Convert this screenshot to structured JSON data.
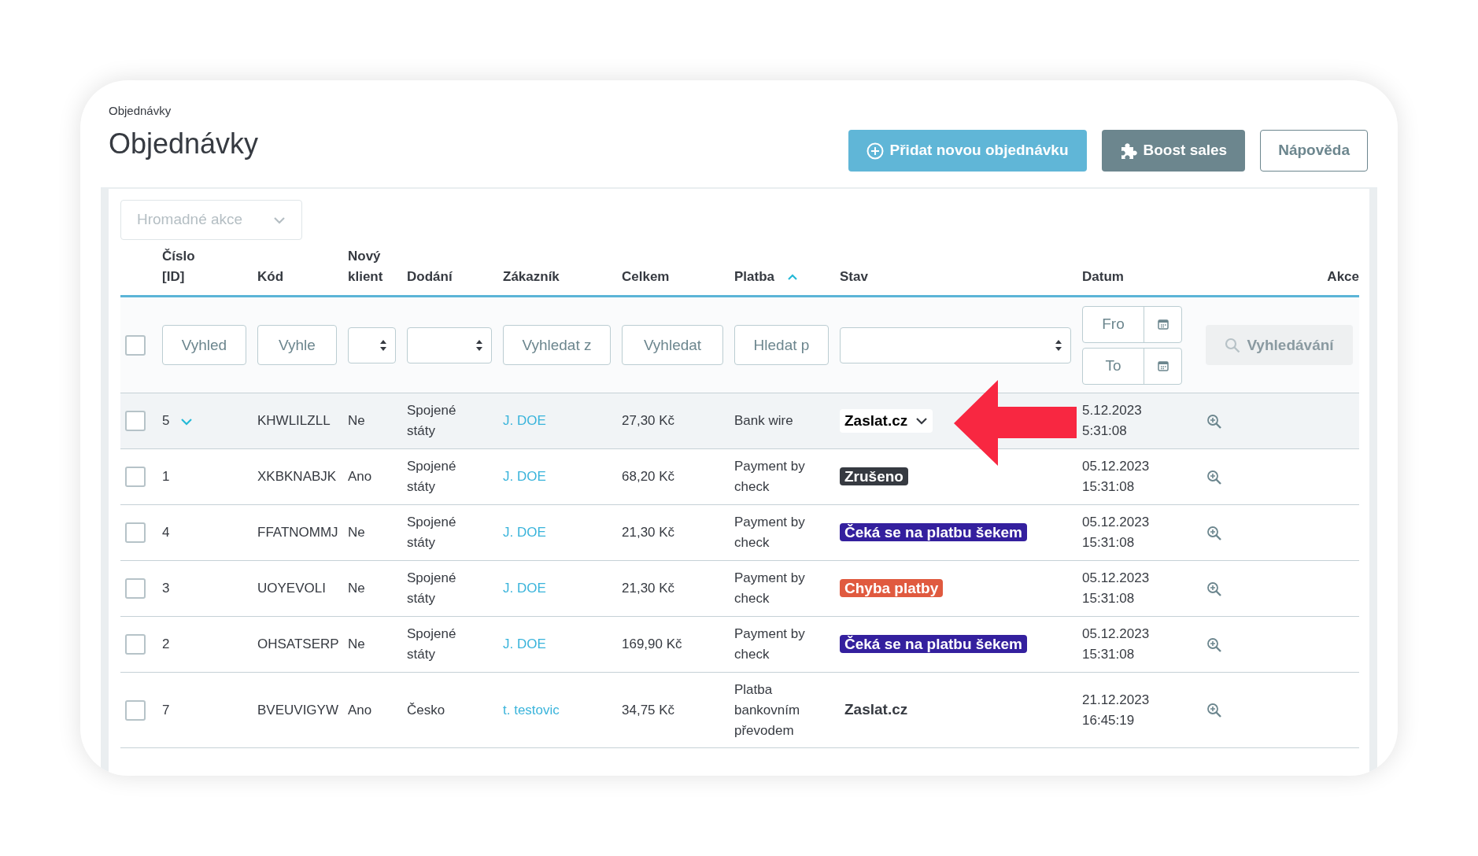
{
  "breadcrumb": "Objednávky",
  "title": "Objednávky",
  "header_buttons": [
    {
      "label": "Přidat novou objednávku",
      "kind": "primary"
    },
    {
      "label": "Boost sales",
      "kind": "secondary"
    },
    {
      "label": "Nápověda",
      "kind": "outline"
    }
  ],
  "bulk_actions": {
    "label": "Hromadné akce",
    "disabled": true
  },
  "table": {
    "columns": [
      {
        "sorted_ascending": false
      },
      {
        "label": "Číslo [ID]",
        "sorted_ascending": false
      },
      {
        "label": "Kód",
        "sorted_ascending": false
      },
      {
        "label": "Nový klient",
        "sorted_ascending": false
      },
      {
        "label": "Dodání",
        "sorted_ascending": false
      },
      {
        "label": "Zákazník",
        "sorted_ascending": false
      },
      {
        "label": "Celkem",
        "sorted_ascending": false
      },
      {
        "label": "Platba",
        "sorted_ascending": true
      },
      {
        "label": "Stav",
        "sorted_ascending": false
      },
      {
        "label": "Datum",
        "sorted_ascending": false
      },
      {
        "label": "Akce",
        "sorted_ascending": false
      }
    ],
    "filters": [
      {
        "kind": "checkbox",
        "checked": false
      },
      {
        "kind": "text",
        "placeholder": "Vyhled"
      },
      {
        "kind": "text",
        "placeholder": "Vyhle"
      },
      {
        "kind": "select"
      },
      {
        "kind": "select"
      },
      {
        "kind": "text",
        "placeholder": "Vyhledat z"
      },
      {
        "kind": "text",
        "placeholder": "Vyhledat"
      },
      {
        "kind": "text",
        "placeholder": "Hledat p"
      },
      {
        "kind": "select"
      },
      {
        "kind": "date_range",
        "from_placeholder": "Fro",
        "to_placeholder": "To"
      },
      {
        "kind": "button",
        "label": "Vyhledávání",
        "disabled": true
      }
    ],
    "rows": [
      {
        "checked": false,
        "highlighted": true,
        "expandable": true,
        "id": "5",
        "code": "KHWLILZLL",
        "new_client": "Ne",
        "delivery": "Spojené státy",
        "customer": "J. DOE",
        "total": "27,30 Kč",
        "payment": "Bank wire",
        "status": {
          "kind": "dropdown",
          "label": "Zaslat.cz"
        },
        "date": "5.12.2023",
        "time": "5:31:08"
      },
      {
        "checked": false,
        "highlighted": false,
        "expandable": false,
        "id": "1",
        "code": "XKBKNABJK",
        "new_client": "Ano",
        "delivery": "Spojené státy",
        "customer": "J. DOE",
        "total": "68,20 Kč",
        "payment": "Payment by check",
        "status": {
          "kind": "badge",
          "label": "Zrušeno",
          "color": "#363a41"
        },
        "date": "05.12.2023",
        "time": "15:31:08"
      },
      {
        "checked": false,
        "highlighted": false,
        "expandable": false,
        "id": "4",
        "code": "FFATNOMMJ",
        "new_client": "Ne",
        "delivery": "Spojené státy",
        "customer": "J. DOE",
        "total": "21,30 Kč",
        "payment": "Payment by check",
        "status": {
          "kind": "badge",
          "label": "Čeká se na platbu šekem",
          "color": "#34209e"
        },
        "date": "05.12.2023",
        "time": "15:31:08"
      },
      {
        "checked": false,
        "highlighted": false,
        "expandable": false,
        "id": "3",
        "code": "UOYEVOLI",
        "new_client": "Ne",
        "delivery": "Spojené státy",
        "customer": "J. DOE",
        "total": "21,30 Kč",
        "payment": "Payment by check",
        "status": {
          "kind": "badge",
          "label": "Chyba platby",
          "color": "#e05a3f"
        },
        "date": "05.12.2023",
        "time": "15:31:08"
      },
      {
        "checked": false,
        "highlighted": false,
        "expandable": false,
        "id": "2",
        "code": "OHSATSERP",
        "new_client": "Ne",
        "delivery": "Spojené státy",
        "customer": "J. DOE",
        "total": "169,90 Kč",
        "payment": "Payment by check",
        "status": {
          "kind": "badge",
          "label": "Čeká se na platbu šekem",
          "color": "#34209e"
        },
        "date": "05.12.2023",
        "time": "15:31:08"
      },
      {
        "checked": false,
        "highlighted": false,
        "expandable": false,
        "id": "7",
        "code": "BVEUVIGYW",
        "new_client": "Ano",
        "delivery": "Česko",
        "customer": "t. testovic",
        "total": "34,75 Kč",
        "payment": "Platba bankovním převodem",
        "status": {
          "kind": "plain",
          "label": "Zaslat.cz"
        },
        "date": "21.12.2023",
        "time": "16:45:19"
      }
    ]
  }
}
